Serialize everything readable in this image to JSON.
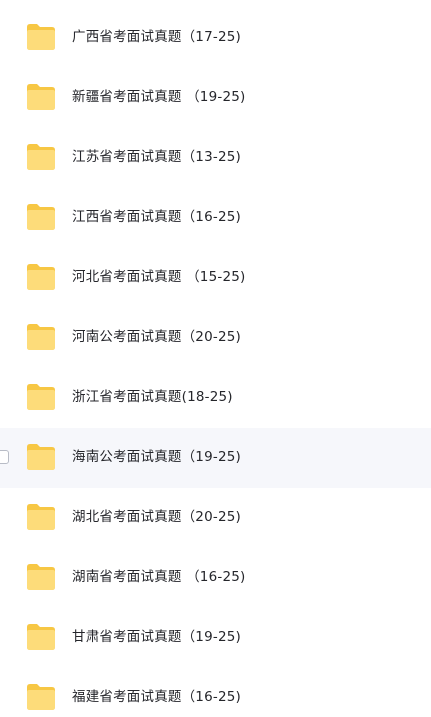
{
  "items": [
    {
      "name": "广西省考面试真题（17-25)"
    },
    {
      "name": "新疆省考面试真题 （19-25)"
    },
    {
      "name": "江苏省考面试真题（13-25)"
    },
    {
      "name": "江西省考面试真题（16-25)"
    },
    {
      "name": "河北省考面试真题 （15-25)"
    },
    {
      "name": "河南公考面试真题（20-25)"
    },
    {
      "name": "浙江省考面试真题(18-25)"
    },
    {
      "name": "海南公考面试真题（19-25)"
    },
    {
      "name": "湖北省考面试真题（20-25)"
    },
    {
      "name": "湖南省考面试真题 （16-25)"
    },
    {
      "name": "甘肃省考面试真题（19-25)"
    },
    {
      "name": "福建省考面试真题（16-25)"
    }
  ],
  "hovered_index": 7,
  "icon": "folder-icon",
  "colors": {
    "folder_back": "#f7c744",
    "folder_front": "#fddc7a",
    "hover_bg": "#f6f7fb",
    "text": "#25262b"
  }
}
